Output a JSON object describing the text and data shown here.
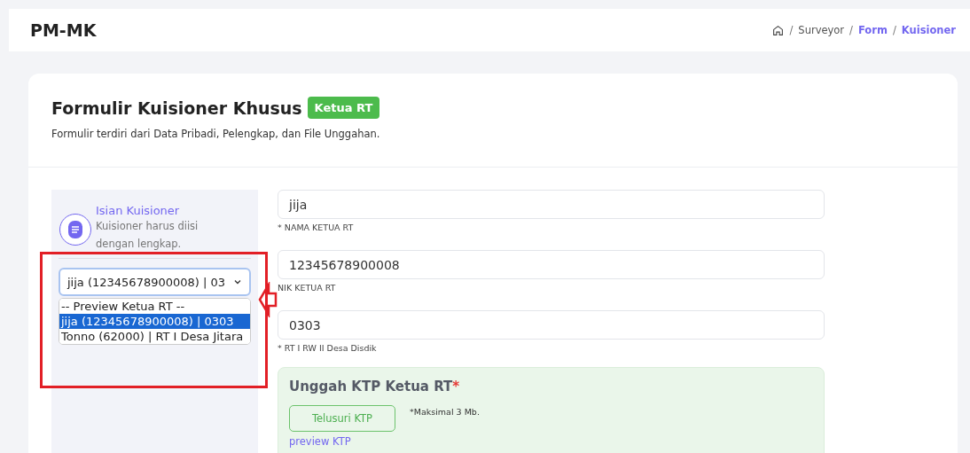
{
  "header": {
    "brand": "PM-MK",
    "breadcrumb": [
      {
        "separator": "/",
        "label": "Surveyor",
        "current": false
      },
      {
        "separator": "/",
        "label": "Form",
        "current": true
      },
      {
        "separator": "/",
        "label": "Kuisioner",
        "current": true
      }
    ]
  },
  "card": {
    "title": "Formulir Kuisioner Khusus",
    "badge": "Ketua RT",
    "subtitle": "Formulir terdiri dari Data Pribadi, Pelengkap, dan File Unggahan."
  },
  "sidebar": {
    "title": "Isian Kuisioner",
    "description": "Kuisioner harus diisi dengan lengkap.",
    "select": {
      "value": "jija (12345678900008) | 03",
      "options": [
        {
          "label": "-- Preview Ketua RT --",
          "selected": false
        },
        {
          "label": "jija (12345678900008) | 0303",
          "selected": true
        },
        {
          "label": "Tonno (62000) | RT I Desa Jitara",
          "selected": false
        }
      ]
    }
  },
  "fields": [
    {
      "value": "jija",
      "label": "* NAMA KETUA RT"
    },
    {
      "value": "12345678900008",
      "label": "NIK KETUA RT"
    },
    {
      "value": "0303",
      "label": "* RT I RW II Desa Disdik"
    }
  ],
  "upload": {
    "title": "Unggah KTP Ketua RT",
    "required_mark": "*",
    "button": "Telusuri KTP",
    "note": "*Maksimal 3 Mb.",
    "link": "preview KTP"
  }
}
